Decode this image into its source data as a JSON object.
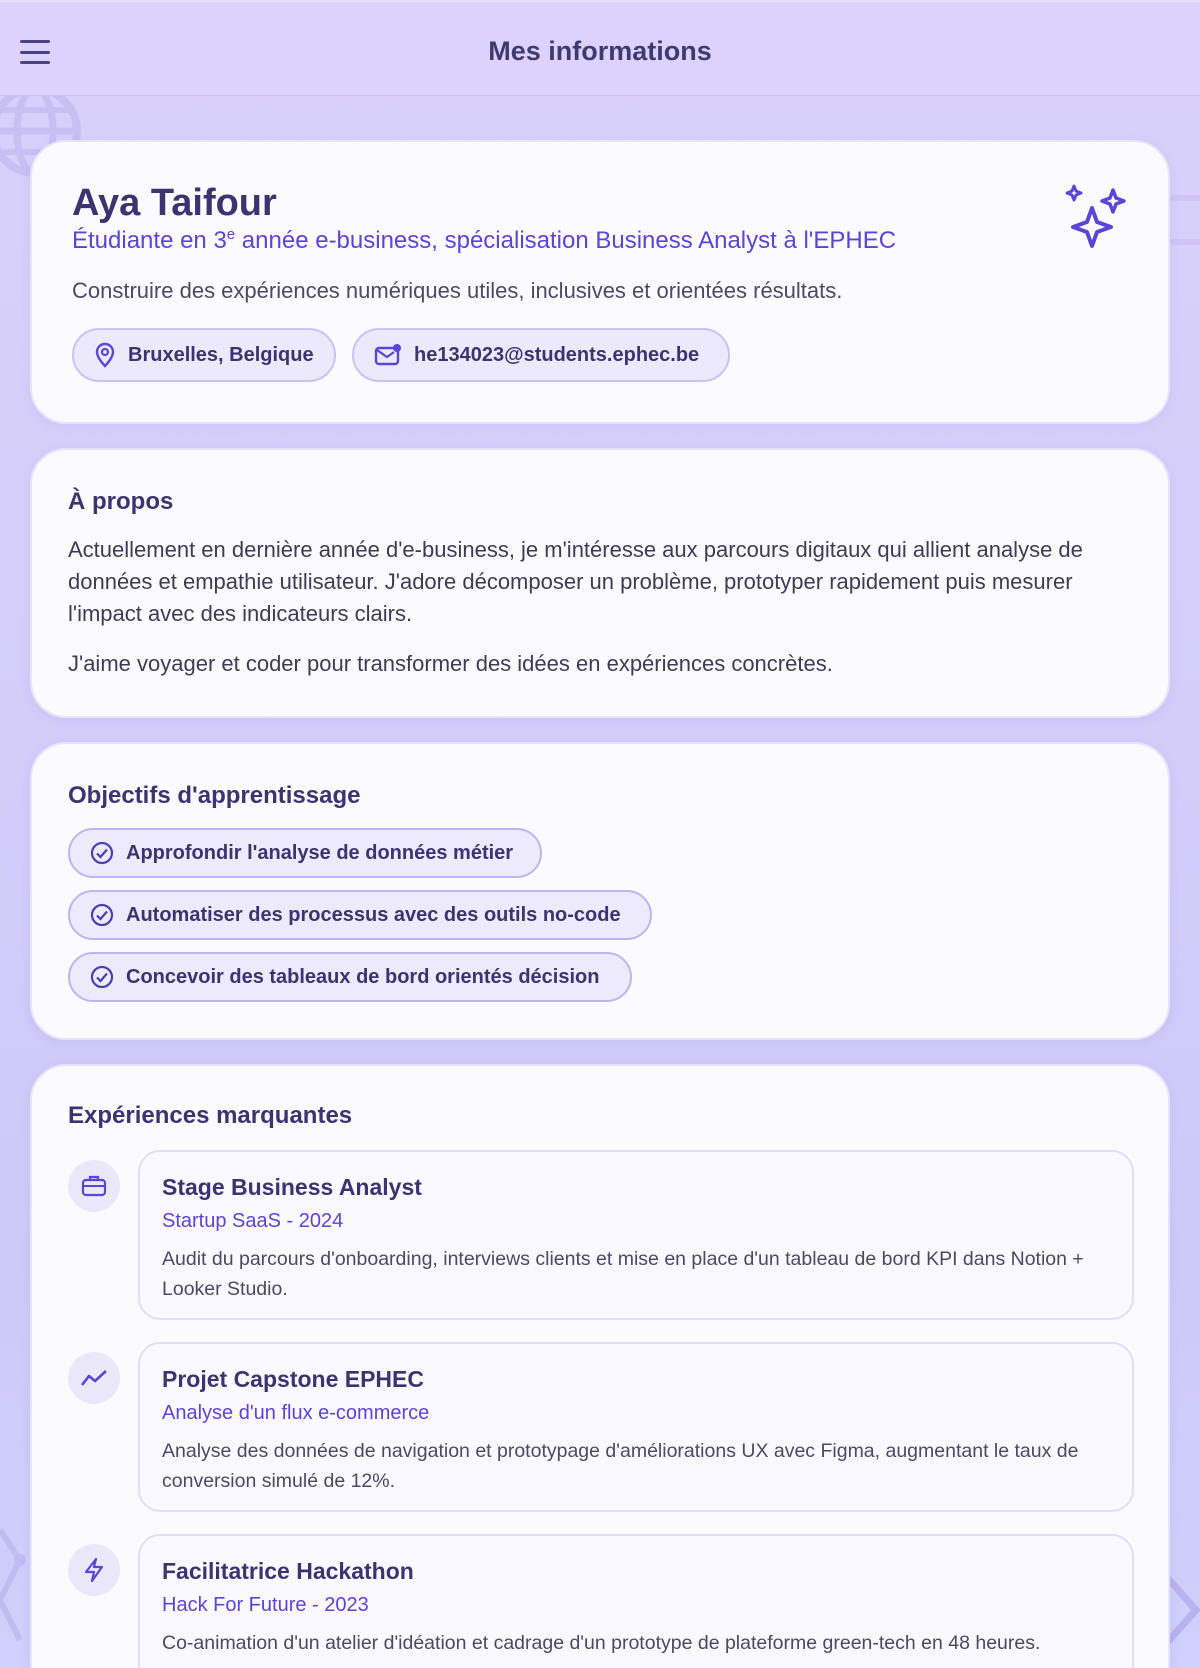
{
  "topbar": {
    "menu_icon": "hamburger-menu-icon",
    "title": "Mes informations"
  },
  "profile": {
    "name": "Aya Taifour",
    "subtitle_pre": "Étudiante en 3",
    "subtitle_sup": "e",
    "subtitle_post": " année e-business, spécialisation Business Analyst à l'EPHEC",
    "tagline": "Construire des expériences numériques utiles, inclusives et orientées résultats.",
    "location": "Bruxelles, Belgique",
    "email": "he134023@students.ephec.be",
    "accent_icon": "sparkles-icon"
  },
  "about": {
    "title": "À propos",
    "paragraph1": "Actuellement en dernière année d'e-business, je m'intéresse aux parcours digitaux qui allient analyse de données et empathie utilisateur. J'adore décomposer un problème, prototyper rapidement puis mesurer l'impact avec des indicateurs clairs.",
    "paragraph2": "J'aime voyager et coder pour transformer des idées en expériences concrètes."
  },
  "goals": {
    "title": "Objectifs d'apprentissage",
    "items": [
      "Approfondir l'analyse de données métier",
      "Automatiser des processus avec des outils no-code",
      "Concevoir des tableaux de bord orientés décision"
    ]
  },
  "experiences": {
    "title": "Expériences marquantes",
    "items": [
      {
        "icon": "briefcase-icon",
        "title": "Stage Business Analyst",
        "subtitle": "Startup SaaS - 2024",
        "description": "Audit du parcours d'onboarding, interviews clients et mise en place d'un tableau de bord KPI dans Notion + Looker Studio."
      },
      {
        "icon": "trend-line-icon",
        "title": "Projet Capstone EPHEC",
        "subtitle": "Analyse d'un flux e-commerce",
        "description": "Analyse des données de navigation et prototypage d'améliorations UX avec Figma, augmentant le taux de conversion simulé de 12%."
      },
      {
        "icon": "lightning-icon",
        "title": "Facilitatrice Hackathon",
        "subtitle": "Hack For Future - 2023",
        "description": "Co-animation d'un atelier d'idéation et cadrage d'un prototype de plateforme green-tech en 48 heures."
      }
    ]
  },
  "colors": {
    "accent": "#5a45d6",
    "text": "#3b3470",
    "background": "#d8d1fb"
  }
}
